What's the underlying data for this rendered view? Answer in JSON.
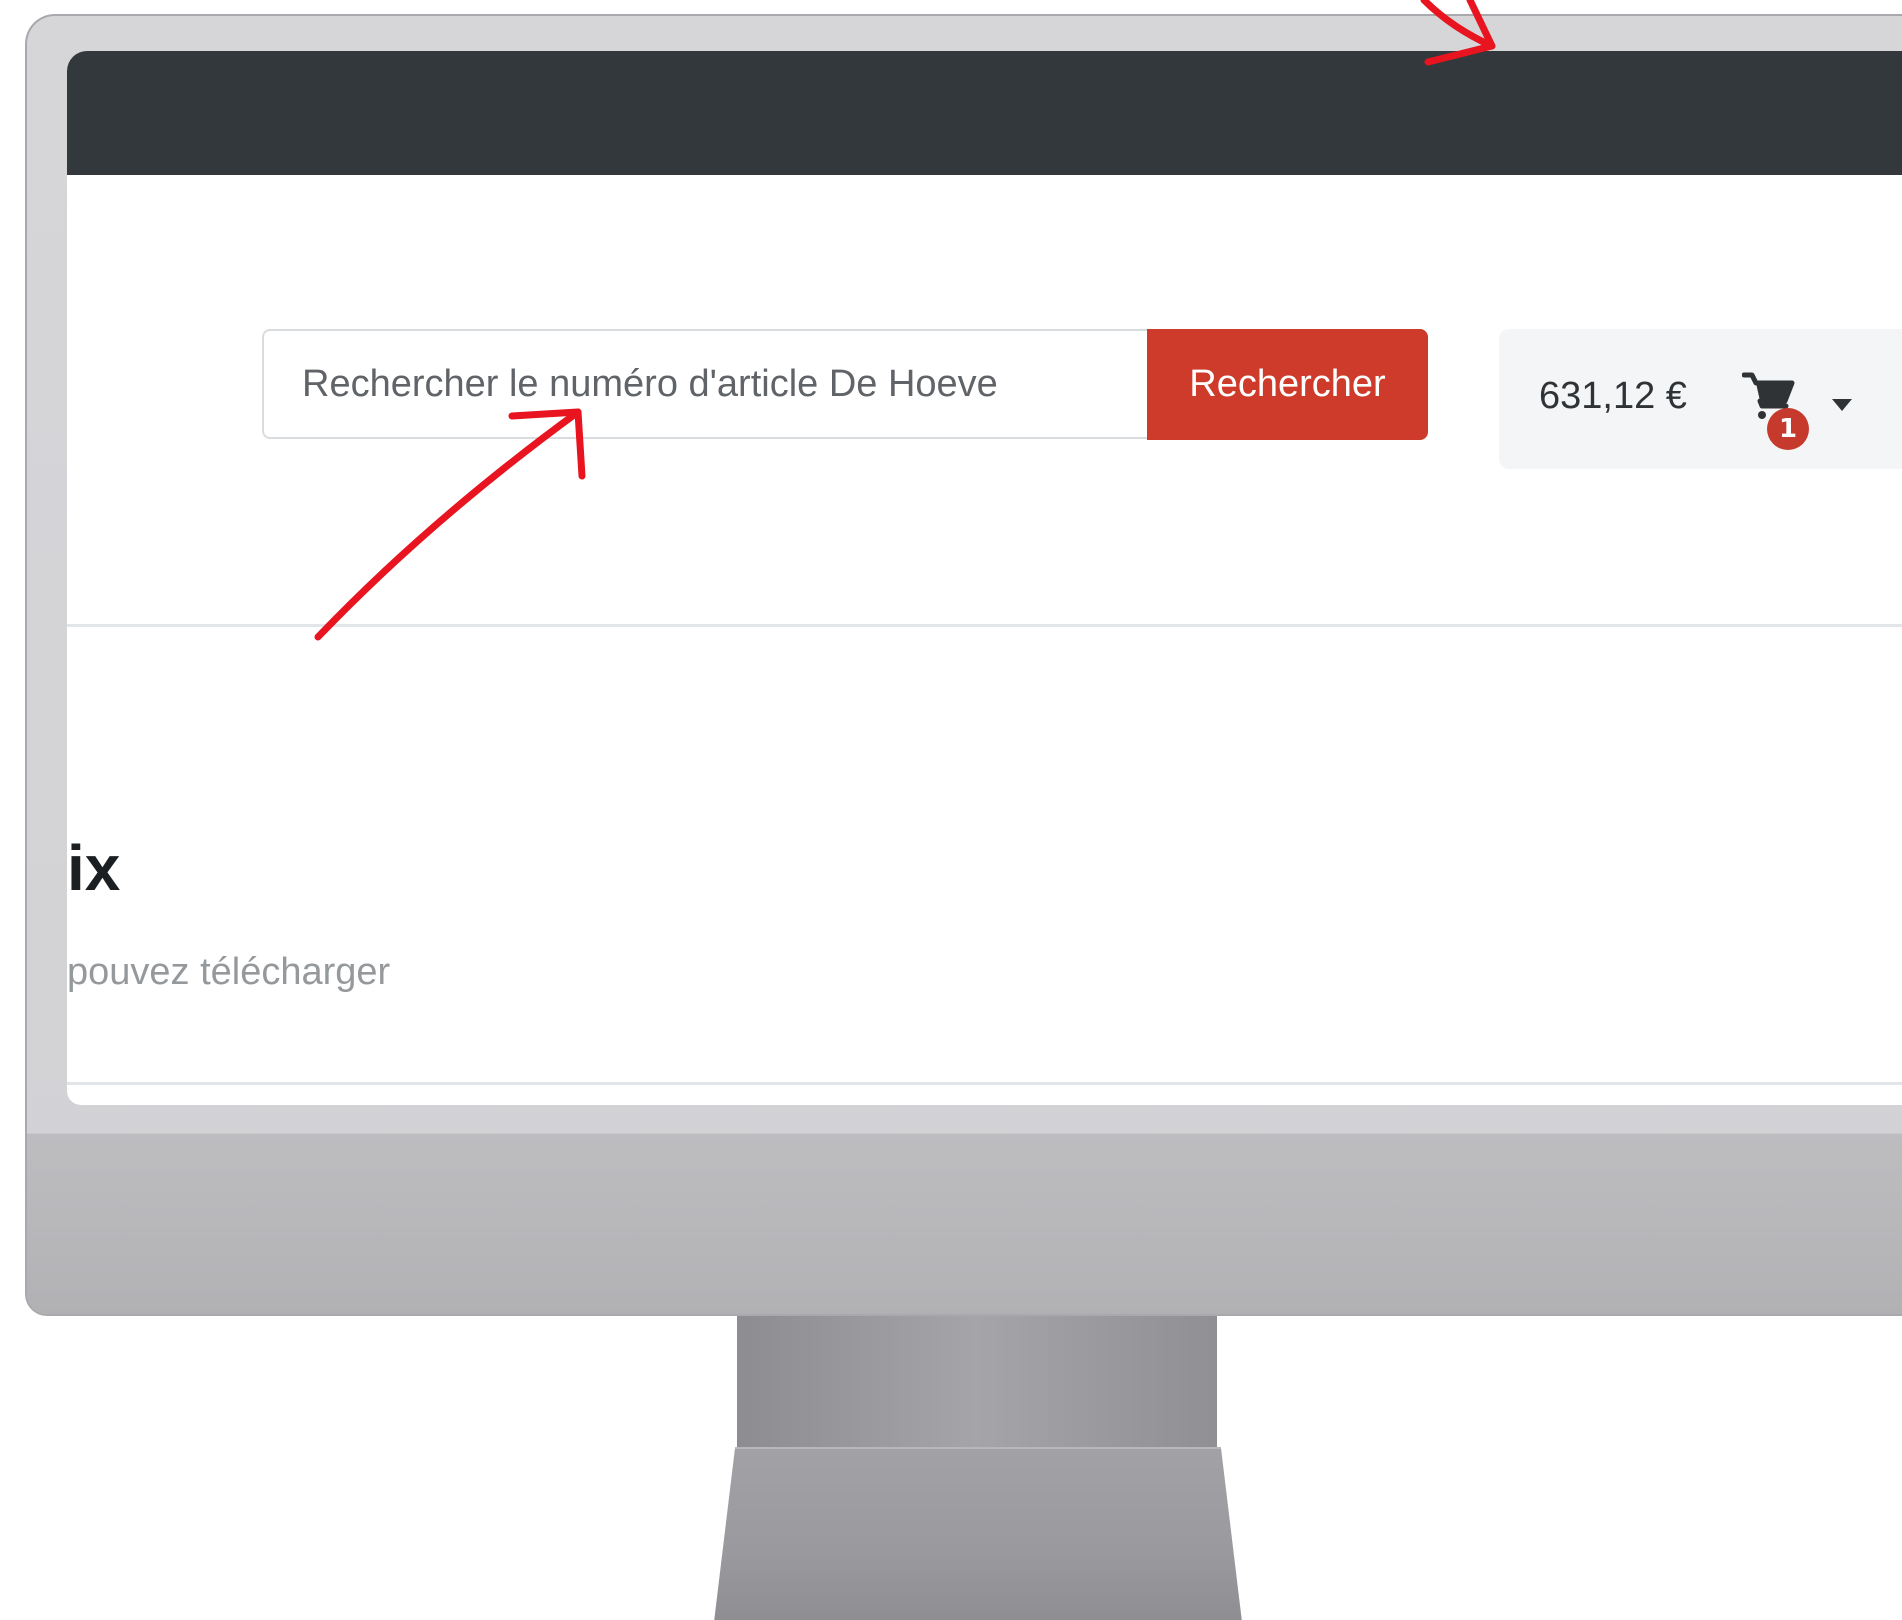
{
  "search": {
    "placeholder": "Rechercher le numéro d'article De Hoeve",
    "button_label": "Rechercher"
  },
  "cart": {
    "total": "631,12 €",
    "badge_count": "1",
    "icon": "shopping-cart-icon"
  },
  "content": {
    "heading": "ix",
    "subtitle": "pouvez télécharger"
  },
  "colors": {
    "topbar": "#33383c",
    "accent": "#cf3b2b",
    "annotation": "#e8141f"
  }
}
